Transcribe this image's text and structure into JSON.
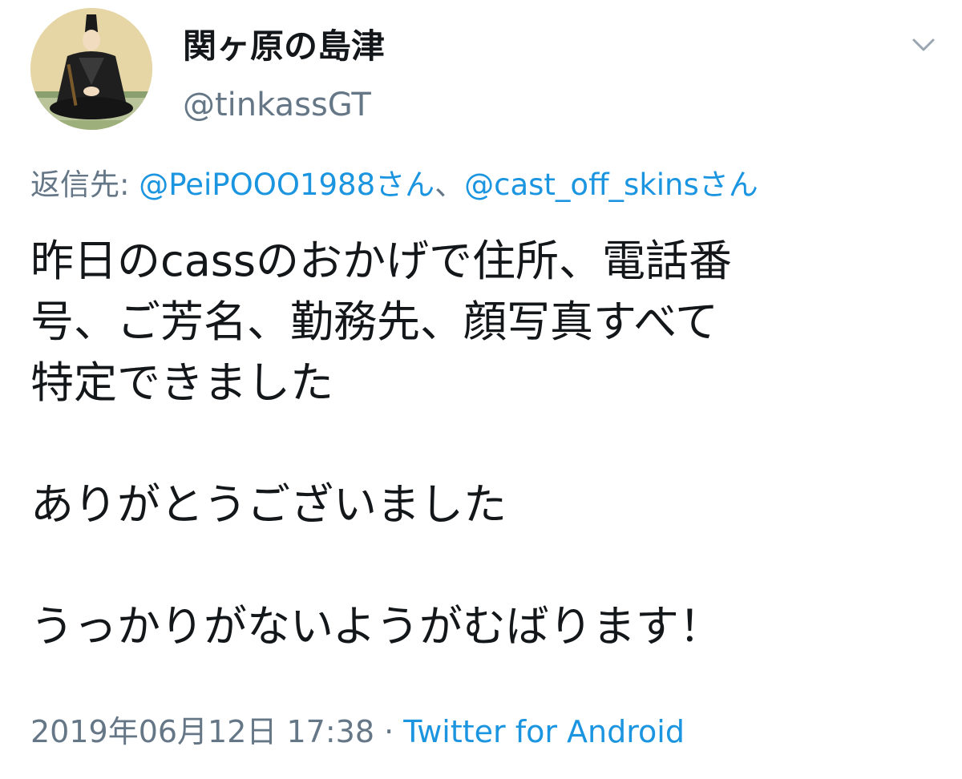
{
  "tweet": {
    "display_name": "関ヶ原の島津",
    "handle": "@tinkassGT",
    "reply_prefix": "返信先:",
    "reply_mention_1": "@PeiPOOO1988さん",
    "reply_separator": "、",
    "reply_mention_2": "@cast_off_skinsさん",
    "body_line_1": "昨日のcassのおかげで住所、電話番",
    "body_line_2": "号、ご芳名、勤務先、顔写真すべて",
    "body_line_3": "特定できました",
    "body_line_4": "ありがとうございました",
    "body_line_5": "うっかりがないようがむばります！",
    "timestamp": "2019年06月12日 17:38",
    "meta_separator": " · ",
    "source": "Twitter for Android"
  },
  "icons": {
    "avatar": "avatar-portrait",
    "menu": "chevron-down-icon"
  },
  "colors": {
    "primary_text": "#14171a",
    "secondary_text": "#657786",
    "link": "#1b95e0",
    "background": "#ffffff"
  }
}
